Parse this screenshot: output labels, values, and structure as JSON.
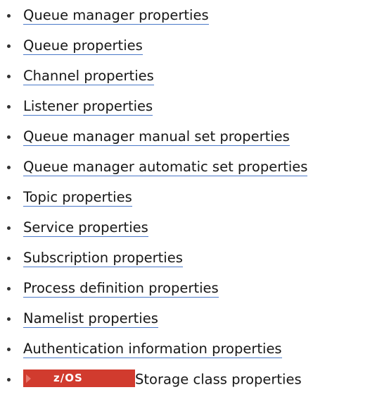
{
  "items": [
    {
      "label": "Queue manager properties"
    },
    {
      "label": "Queue properties"
    },
    {
      "label": "Channel properties"
    },
    {
      "label": "Listener properties"
    },
    {
      "label": "Queue manager manual set properties"
    },
    {
      "label": "Queue manager automatic set properties"
    },
    {
      "label": "Topic properties"
    },
    {
      "label": "Service properties"
    },
    {
      "label": "Subscription properties"
    },
    {
      "label": "Process definition properties"
    },
    {
      "label": "Namelist properties"
    },
    {
      "label": "Authentication information properties"
    }
  ],
  "last_item": {
    "badge_label": "z/OS",
    "badge_icon": "arrow-right-icon",
    "text": "Storage class properties"
  },
  "colors": {
    "link_underline": "#4a79c8",
    "badge_background": "#d13b2e"
  }
}
